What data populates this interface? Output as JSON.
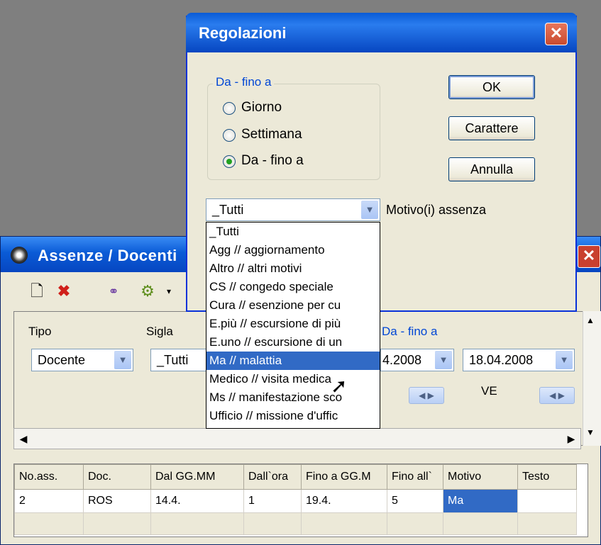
{
  "background_window": {
    "title": "Assenze / Docenti",
    "filter": {
      "tipo_label": "Tipo",
      "tipo_value": "Docente",
      "sigla_label": "Sigla",
      "sigla_value": "_Tutti",
      "group_legend": "Da - fino a",
      "date_from": "4.2008",
      "date_to": "18.04.2008",
      "weekday_label": "VE"
    },
    "grid": {
      "columns": [
        "No.ass.",
        "Doc.",
        "Dal GG.MM",
        "Dall`ora",
        "Fino a GG.M",
        "Fino all`",
        "Motivo",
        "Testo"
      ],
      "rows": [
        [
          "2",
          "ROS",
          "14.4.",
          "1",
          "19.4.",
          "5",
          "Ma",
          ""
        ]
      ]
    }
  },
  "dialog": {
    "title": "Regolazioni",
    "group_legend": "Da - fino a",
    "radios": [
      {
        "label": "Giorno",
        "selected": false
      },
      {
        "label": "Settimana",
        "selected": false
      },
      {
        "label": "Da - fino a",
        "selected": true
      }
    ],
    "buttons": {
      "ok": "OK",
      "carattere": "Carattere",
      "annulla": "Annulla"
    },
    "motivo_combo_value": "_Tutti",
    "motivo_label": "Motivo(i) assenza",
    "dropdown_items": [
      "_Tutti",
      "Agg // aggiornamento",
      "Altro // altri motivi",
      "CS // congedo speciale",
      "Cura // esenzione per cu",
      "E.più // escursione di più",
      "E.uno // escursione di un",
      "Ma // malattia",
      "Medico // visita medica",
      "Ms // manifestazione sco",
      "Ufficio // missione d'uffic"
    ],
    "dropdown_selected_index": 7
  },
  "colors": {
    "title_blue": "#0a5bd6",
    "selection_blue": "#316ac5",
    "window_face": "#ece9d8",
    "close_red": "#c94b2f"
  }
}
